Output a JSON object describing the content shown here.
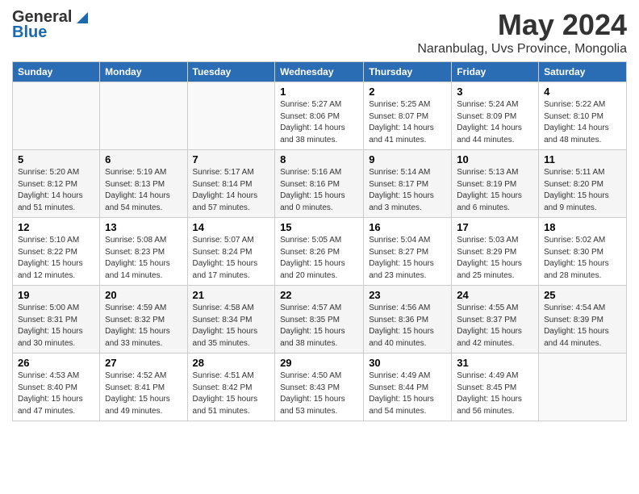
{
  "header": {
    "logo_general": "General",
    "logo_blue": "Blue",
    "month_title": "May 2024",
    "location": "Naranbulag, Uvs Province, Mongolia"
  },
  "days_of_week": [
    "Sunday",
    "Monday",
    "Tuesday",
    "Wednesday",
    "Thursday",
    "Friday",
    "Saturday"
  ],
  "weeks": [
    [
      {
        "day": "",
        "sunrise": "",
        "sunset": "",
        "daylight": ""
      },
      {
        "day": "",
        "sunrise": "",
        "sunset": "",
        "daylight": ""
      },
      {
        "day": "",
        "sunrise": "",
        "sunset": "",
        "daylight": ""
      },
      {
        "day": "1",
        "sunrise": "Sunrise: 5:27 AM",
        "sunset": "Sunset: 8:06 PM",
        "daylight": "Daylight: 14 hours and 38 minutes."
      },
      {
        "day": "2",
        "sunrise": "Sunrise: 5:25 AM",
        "sunset": "Sunset: 8:07 PM",
        "daylight": "Daylight: 14 hours and 41 minutes."
      },
      {
        "day": "3",
        "sunrise": "Sunrise: 5:24 AM",
        "sunset": "Sunset: 8:09 PM",
        "daylight": "Daylight: 14 hours and 44 minutes."
      },
      {
        "day": "4",
        "sunrise": "Sunrise: 5:22 AM",
        "sunset": "Sunset: 8:10 PM",
        "daylight": "Daylight: 14 hours and 48 minutes."
      }
    ],
    [
      {
        "day": "5",
        "sunrise": "Sunrise: 5:20 AM",
        "sunset": "Sunset: 8:12 PM",
        "daylight": "Daylight: 14 hours and 51 minutes."
      },
      {
        "day": "6",
        "sunrise": "Sunrise: 5:19 AM",
        "sunset": "Sunset: 8:13 PM",
        "daylight": "Daylight: 14 hours and 54 minutes."
      },
      {
        "day": "7",
        "sunrise": "Sunrise: 5:17 AM",
        "sunset": "Sunset: 8:14 PM",
        "daylight": "Daylight: 14 hours and 57 minutes."
      },
      {
        "day": "8",
        "sunrise": "Sunrise: 5:16 AM",
        "sunset": "Sunset: 8:16 PM",
        "daylight": "Daylight: 15 hours and 0 minutes."
      },
      {
        "day": "9",
        "sunrise": "Sunrise: 5:14 AM",
        "sunset": "Sunset: 8:17 PM",
        "daylight": "Daylight: 15 hours and 3 minutes."
      },
      {
        "day": "10",
        "sunrise": "Sunrise: 5:13 AM",
        "sunset": "Sunset: 8:19 PM",
        "daylight": "Daylight: 15 hours and 6 minutes."
      },
      {
        "day": "11",
        "sunrise": "Sunrise: 5:11 AM",
        "sunset": "Sunset: 8:20 PM",
        "daylight": "Daylight: 15 hours and 9 minutes."
      }
    ],
    [
      {
        "day": "12",
        "sunrise": "Sunrise: 5:10 AM",
        "sunset": "Sunset: 8:22 PM",
        "daylight": "Daylight: 15 hours and 12 minutes."
      },
      {
        "day": "13",
        "sunrise": "Sunrise: 5:08 AM",
        "sunset": "Sunset: 8:23 PM",
        "daylight": "Daylight: 15 hours and 14 minutes."
      },
      {
        "day": "14",
        "sunrise": "Sunrise: 5:07 AM",
        "sunset": "Sunset: 8:24 PM",
        "daylight": "Daylight: 15 hours and 17 minutes."
      },
      {
        "day": "15",
        "sunrise": "Sunrise: 5:05 AM",
        "sunset": "Sunset: 8:26 PM",
        "daylight": "Daylight: 15 hours and 20 minutes."
      },
      {
        "day": "16",
        "sunrise": "Sunrise: 5:04 AM",
        "sunset": "Sunset: 8:27 PM",
        "daylight": "Daylight: 15 hours and 23 minutes."
      },
      {
        "day": "17",
        "sunrise": "Sunrise: 5:03 AM",
        "sunset": "Sunset: 8:29 PM",
        "daylight": "Daylight: 15 hours and 25 minutes."
      },
      {
        "day": "18",
        "sunrise": "Sunrise: 5:02 AM",
        "sunset": "Sunset: 8:30 PM",
        "daylight": "Daylight: 15 hours and 28 minutes."
      }
    ],
    [
      {
        "day": "19",
        "sunrise": "Sunrise: 5:00 AM",
        "sunset": "Sunset: 8:31 PM",
        "daylight": "Daylight: 15 hours and 30 minutes."
      },
      {
        "day": "20",
        "sunrise": "Sunrise: 4:59 AM",
        "sunset": "Sunset: 8:32 PM",
        "daylight": "Daylight: 15 hours and 33 minutes."
      },
      {
        "day": "21",
        "sunrise": "Sunrise: 4:58 AM",
        "sunset": "Sunset: 8:34 PM",
        "daylight": "Daylight: 15 hours and 35 minutes."
      },
      {
        "day": "22",
        "sunrise": "Sunrise: 4:57 AM",
        "sunset": "Sunset: 8:35 PM",
        "daylight": "Daylight: 15 hours and 38 minutes."
      },
      {
        "day": "23",
        "sunrise": "Sunrise: 4:56 AM",
        "sunset": "Sunset: 8:36 PM",
        "daylight": "Daylight: 15 hours and 40 minutes."
      },
      {
        "day": "24",
        "sunrise": "Sunrise: 4:55 AM",
        "sunset": "Sunset: 8:37 PM",
        "daylight": "Daylight: 15 hours and 42 minutes."
      },
      {
        "day": "25",
        "sunrise": "Sunrise: 4:54 AM",
        "sunset": "Sunset: 8:39 PM",
        "daylight": "Daylight: 15 hours and 44 minutes."
      }
    ],
    [
      {
        "day": "26",
        "sunrise": "Sunrise: 4:53 AM",
        "sunset": "Sunset: 8:40 PM",
        "daylight": "Daylight: 15 hours and 47 minutes."
      },
      {
        "day": "27",
        "sunrise": "Sunrise: 4:52 AM",
        "sunset": "Sunset: 8:41 PM",
        "daylight": "Daylight: 15 hours and 49 minutes."
      },
      {
        "day": "28",
        "sunrise": "Sunrise: 4:51 AM",
        "sunset": "Sunset: 8:42 PM",
        "daylight": "Daylight: 15 hours and 51 minutes."
      },
      {
        "day": "29",
        "sunrise": "Sunrise: 4:50 AM",
        "sunset": "Sunset: 8:43 PM",
        "daylight": "Daylight: 15 hours and 53 minutes."
      },
      {
        "day": "30",
        "sunrise": "Sunrise: 4:49 AM",
        "sunset": "Sunset: 8:44 PM",
        "daylight": "Daylight: 15 hours and 54 minutes."
      },
      {
        "day": "31",
        "sunrise": "Sunrise: 4:49 AM",
        "sunset": "Sunset: 8:45 PM",
        "daylight": "Daylight: 15 hours and 56 minutes."
      },
      {
        "day": "",
        "sunrise": "",
        "sunset": "",
        "daylight": ""
      }
    ]
  ]
}
